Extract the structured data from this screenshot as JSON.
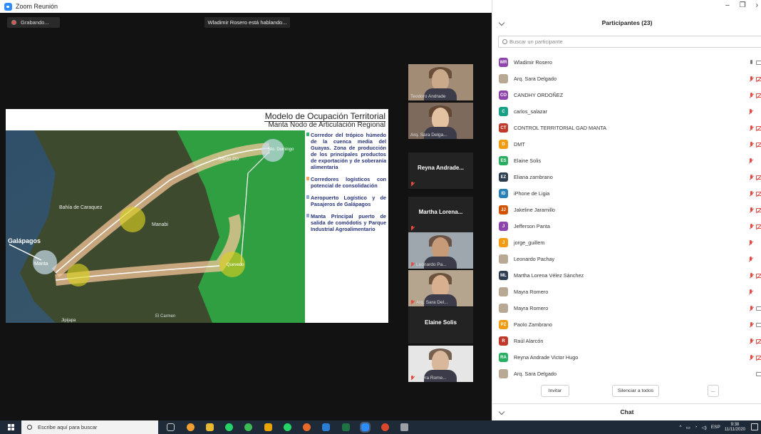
{
  "window": {
    "title": "Zoom Reunión"
  },
  "meeting": {
    "recording_label": "Grabando...",
    "speaking_label": "Wladimir Rosero está hablando..."
  },
  "slide": {
    "title": "Modelo de Ocupación Territorial",
    "subtitle": "Manta Nodo de Articulación Regional",
    "legend": [
      {
        "color": "#3cb371",
        "text": "Corredor del trópico húmedo de la cuenca media del Guayas. Zona de producción de los principales productos de exportación y de soberanía alimentaria"
      },
      {
        "color": "#f4a460",
        "text": "Corredores logísticos con potencial de consolidación"
      },
      {
        "color": "#8fa8d8",
        "text": "Aeropuerto Logístico y de Pasajeros de Galápagos"
      },
      {
        "color": "#8fa8d8",
        "text": "Manta Principal puerto de salida de comódotis y Parque Industrial Agroalimentario"
      }
    ],
    "map_labels": {
      "santo_domingo": "Santo Do",
      "sto_domingo": "Sto. Domingo",
      "bahia": "Bahía de Caraquez",
      "manabi": "Manabi",
      "galapagos": "Galápagos",
      "manta": "Manta",
      "quevedo": "Quevedo",
      "jipijapa": "Jipijapa",
      "elcarmen": "El Carmen"
    }
  },
  "thumbnails": [
    {
      "name": "Teodoro Andrade",
      "type": "video",
      "muted": false,
      "skin": "#c9a98a",
      "bg": "#a38c75"
    },
    {
      "name": "Arq. Sara Delga...",
      "type": "video",
      "muted": false,
      "skin": "#e2c2a0",
      "bg": "#7d6a5c"
    },
    {
      "name": "Reyna Andrade...",
      "type": "name",
      "muted": true
    },
    {
      "name": "Martha Lorena...",
      "type": "name",
      "muted": true
    },
    {
      "name": "Leonardo Pa...",
      "type": "video",
      "muted": true,
      "skin": "#c79b78",
      "bg": "#9ea7ad"
    },
    {
      "name": "Arq. Sara Del...",
      "type": "video",
      "muted": true,
      "skin": "#d8b090",
      "bg": "#b5a58e"
    },
    {
      "name": "Elaine Solis",
      "type": "name",
      "muted": false
    },
    {
      "name": "Mayra Rome...",
      "type": "video",
      "muted": true,
      "skin": "#d8b79a",
      "bg": "#e6e6e6"
    }
  ],
  "panel": {
    "title": "Participantes (23)",
    "search_placeholder": "Buscar un participante",
    "invite_label": "Invitar",
    "mute_all_label": "Silenciar a todos",
    "more_label": "...",
    "chat_label": "Chat",
    "participants": [
      {
        "initials": "WR",
        "color": "#8e44ad",
        "name": "Wladimir Rosero",
        "mic": "on",
        "cam": "on"
      },
      {
        "initials": "",
        "color": "photo",
        "name": "Arq. Sara Delgado",
        "mic": "off",
        "cam": "off"
      },
      {
        "initials": "CO",
        "color": "#8e44ad",
        "name": "CANDHY ORDOÑEZ",
        "mic": "off",
        "cam": "off"
      },
      {
        "initials": "C",
        "color": "#16a085",
        "name": "carlos_salazar",
        "mic": "off",
        "cam": "none"
      },
      {
        "initials": "CT",
        "color": "#c0392b",
        "name": "CONTROL TERRITORIAL GAD MANTA",
        "mic": "off",
        "cam": "off"
      },
      {
        "initials": "D",
        "color": "#f39c12",
        "name": "DMT",
        "mic": "off",
        "cam": "off"
      },
      {
        "initials": "ES",
        "color": "#27ae60",
        "name": "Elaine Solis",
        "mic": "off",
        "cam": "none"
      },
      {
        "initials": "EZ",
        "color": "#2c3e50",
        "name": "Eliana zambrano",
        "mic": "off",
        "cam": "off"
      },
      {
        "initials": "ID",
        "color": "#2980b9",
        "name": "iPhone de Ligia",
        "mic": "off",
        "cam": "off"
      },
      {
        "initials": "JJ",
        "color": "#d35400",
        "name": "Jakeline Jaramillo",
        "mic": "off",
        "cam": "off"
      },
      {
        "initials": "J",
        "color": "#8e44ad",
        "name": "Jefferson Panta",
        "mic": "off",
        "cam": "off"
      },
      {
        "initials": "J",
        "color": "#f39c12",
        "name": "jorge_guillem",
        "mic": "off",
        "cam": "none"
      },
      {
        "initials": "",
        "color": "photo",
        "name": "Leonardo Pachay",
        "mic": "off",
        "cam": "none"
      },
      {
        "initials": "ML",
        "color": "#2c3e50",
        "name": "Martha Lorena Vélez Sánchez",
        "mic": "off",
        "cam": "off"
      },
      {
        "initials": "",
        "color": "photo",
        "name": "Mayra Romero",
        "mic": "off",
        "cam": "none"
      },
      {
        "initials": "",
        "color": "photo",
        "name": "Mayra Romero",
        "mic": "off",
        "cam": "on"
      },
      {
        "initials": "PZ",
        "color": "#f39c12",
        "name": "Paolo Zambrano",
        "mic": "off",
        "cam": "on"
      },
      {
        "initials": "R",
        "color": "#c0392b",
        "name": "Raúl Alarcón",
        "mic": "off",
        "cam": "off"
      },
      {
        "initials": "RA",
        "color": "#27ae60",
        "name": "Reyna Andrade Victor Hugo",
        "mic": "off",
        "cam": "off"
      },
      {
        "initials": "",
        "color": "photo",
        "name": "Arq. Sara Delgado",
        "mic": "none",
        "cam": "on"
      }
    ]
  },
  "taskbar": {
    "search_placeholder": "Escribe aquí para buscar",
    "language": "ESP",
    "time": "9:38",
    "date": "11/11/2020"
  }
}
